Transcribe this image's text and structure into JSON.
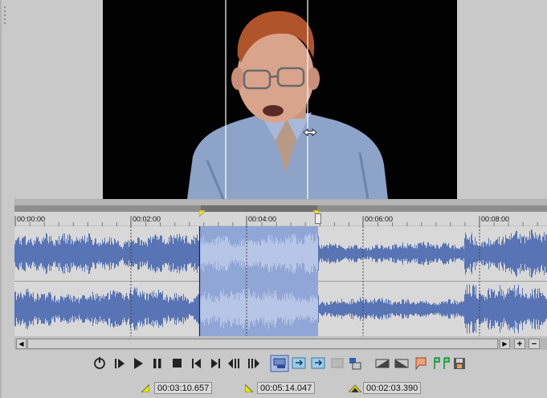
{
  "video": {
    "description_icon": "presenter-video-frame"
  },
  "ruler": {
    "ticks": [
      "00:00:00",
      "00:02:00",
      "00:04:00",
      "00:06:00",
      "00:08:00"
    ]
  },
  "transport": {
    "buttons": [
      "loop-icon",
      "play-from-start-icon",
      "play-icon",
      "pause-icon",
      "stop-icon",
      "prev-marker-icon",
      "next-marker-icon",
      "frame-back-icon",
      "frame-forward-icon"
    ],
    "tools": [
      "edit-tool-icon",
      "loop-in-icon",
      "loop-out-icon",
      "snap-icon",
      "trim-icon",
      "fade-in-icon",
      "fade-out-icon",
      "marker-icon",
      "region-icon",
      "save-icon"
    ]
  },
  "timecodes": {
    "selection_start": "00:03:10.657",
    "selection_end": "00:05:14.047",
    "selection_length": "00:02:03.390"
  },
  "colors": {
    "waveform": "#5874b4",
    "selection": "#8fa6d6",
    "track_bg": "#d8d8d8"
  }
}
